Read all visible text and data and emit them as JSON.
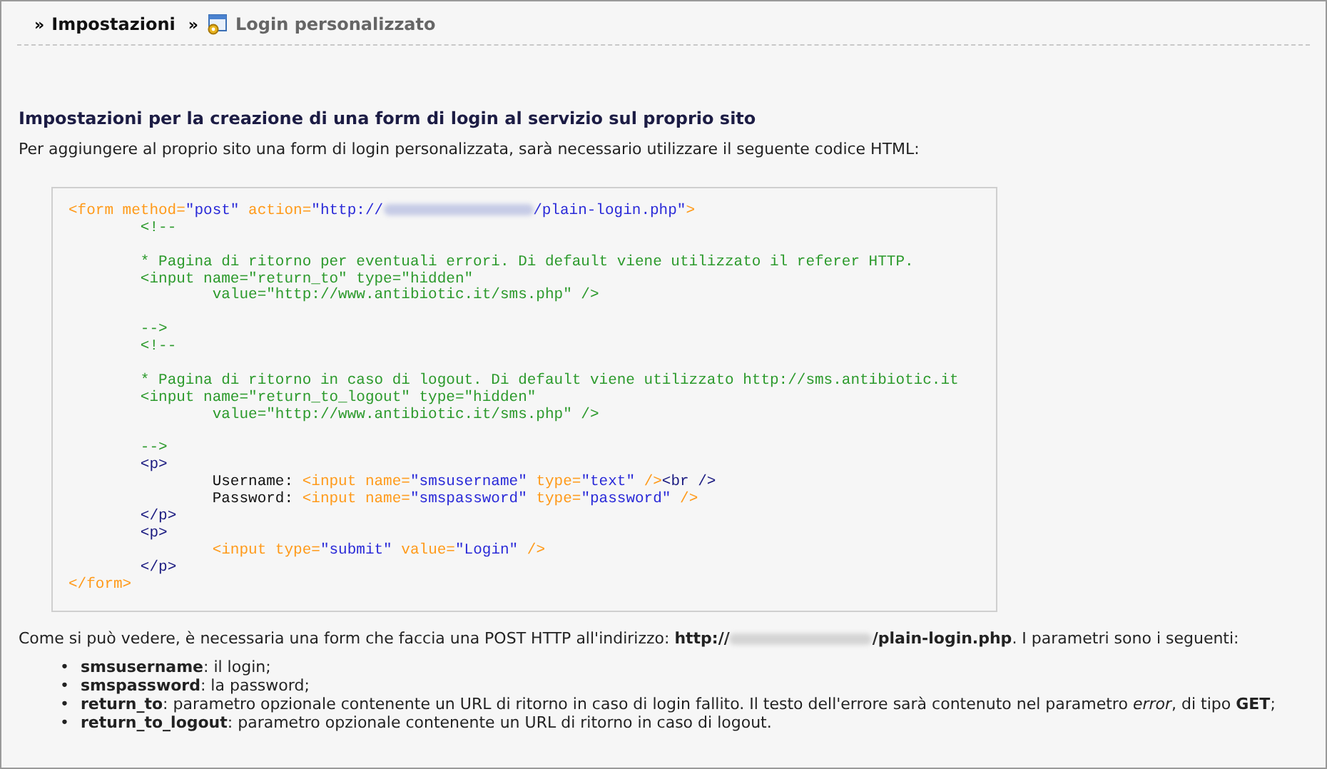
{
  "breadcrumb": [
    {
      "separator": "»",
      "label": "Impostazioni",
      "current": false
    },
    {
      "separator": "»",
      "label": "Login personalizzato",
      "current": true
    }
  ],
  "heading": "Impostazioni per la creazione di una form di login al servizio sul proprio sito",
  "intro": "Per aggiungere al proprio sito una form di login personalizzata, sarà necessario utilizzare il seguente codice HTML:",
  "code_lines": [
    [
      {
        "kind": "tag",
        "text": "<form method="
      },
      {
        "kind": "val",
        "text": "\"post\""
      },
      {
        "kind": "tag",
        "text": " action="
      },
      {
        "kind": "val",
        "text": "\"http://"
      },
      {
        "kind": "redact"
      },
      {
        "kind": "val",
        "text": "/plain-login.php\""
      },
      {
        "kind": "tag",
        "text": ">"
      }
    ],
    [
      {
        "kind": "comment",
        "text": "\t<!--"
      }
    ],
    [
      {
        "kind": "blank"
      }
    ],
    [
      {
        "kind": "comment",
        "text": "\t* Pagina di ritorno per eventuali errori. Di default viene utilizzato il referer HTTP."
      }
    ],
    [
      {
        "kind": "comment",
        "text": "\t<input name=\"return_to\" type=\"hidden\""
      }
    ],
    [
      {
        "kind": "comment",
        "text": "\t\tvalue=\"http://www.antibiotic.it/sms.php\" />"
      }
    ],
    [
      {
        "kind": "blank"
      }
    ],
    [
      {
        "kind": "comment",
        "text": "\t-->"
      }
    ],
    [
      {
        "kind": "comment",
        "text": "\t<!--"
      }
    ],
    [
      {
        "kind": "blank"
      }
    ],
    [
      {
        "kind": "comment",
        "text": "\t* Pagina di ritorno in caso di logout. Di default viene utilizzato http://sms.antibiotic.it"
      }
    ],
    [
      {
        "kind": "comment",
        "text": "\t<input name=\"return_to_logout\" type=\"hidden\""
      }
    ],
    [
      {
        "kind": "comment",
        "text": "\t\tvalue=\"http://www.antibiotic.it/sms.php\" />"
      }
    ],
    [
      {
        "kind": "blank"
      }
    ],
    [
      {
        "kind": "comment",
        "text": "\t-->"
      }
    ],
    [
      {
        "kind": "html",
        "text": "\t<p>"
      }
    ],
    [
      {
        "kind": "text",
        "text": "\t\tUsername: "
      },
      {
        "kind": "tag",
        "text": "<input name="
      },
      {
        "kind": "val",
        "text": "\"smsusername\""
      },
      {
        "kind": "tag",
        "text": " type="
      },
      {
        "kind": "val",
        "text": "\"text\""
      },
      {
        "kind": "tag",
        "text": " />"
      },
      {
        "kind": "html",
        "text": "<br />"
      }
    ],
    [
      {
        "kind": "text",
        "text": "\t\tPassword: "
      },
      {
        "kind": "tag",
        "text": "<input name="
      },
      {
        "kind": "val",
        "text": "\"smspassword\""
      },
      {
        "kind": "tag",
        "text": " type="
      },
      {
        "kind": "val",
        "text": "\"password\""
      },
      {
        "kind": "tag",
        "text": " />"
      }
    ],
    [
      {
        "kind": "html",
        "text": "\t</p>"
      }
    ],
    [
      {
        "kind": "html",
        "text": "\t<p>"
      }
    ],
    [
      {
        "kind": "tag",
        "text": "\t\t<input type="
      },
      {
        "kind": "val",
        "text": "\"submit\""
      },
      {
        "kind": "tag",
        "text": " value="
      },
      {
        "kind": "val",
        "text": "\"Login\""
      },
      {
        "kind": "tag",
        "text": " />"
      }
    ],
    [
      {
        "kind": "html",
        "text": "\t</p>"
      }
    ],
    [
      {
        "kind": "tag",
        "text": "</form>"
      }
    ]
  ],
  "explanation_before": "Come si può vedere, è necessaria una form che faccia una POST HTTP all'indirizzo: **http://**",
  "explanation_after": "**/plain-login.php**. I parametri sono i seguenti:",
  "parameters": [
    {
      "bullet": "•",
      "text": "**smsusername**: il login;"
    },
    {
      "bullet": "•",
      "text": "**smspassword**: la password;"
    },
    {
      "bullet": "•",
      "text": "**return_to**: parametro opzionale contenente un URL di ritorno in caso di login fallito. Il testo dell'errore sarà contenuto nel parametro *error*, di tipo **GET**;"
    },
    {
      "bullet": "•",
      "text": "**return_to_logout**: parametro opzionale contenente un URL di ritorno in caso di logout."
    }
  ]
}
